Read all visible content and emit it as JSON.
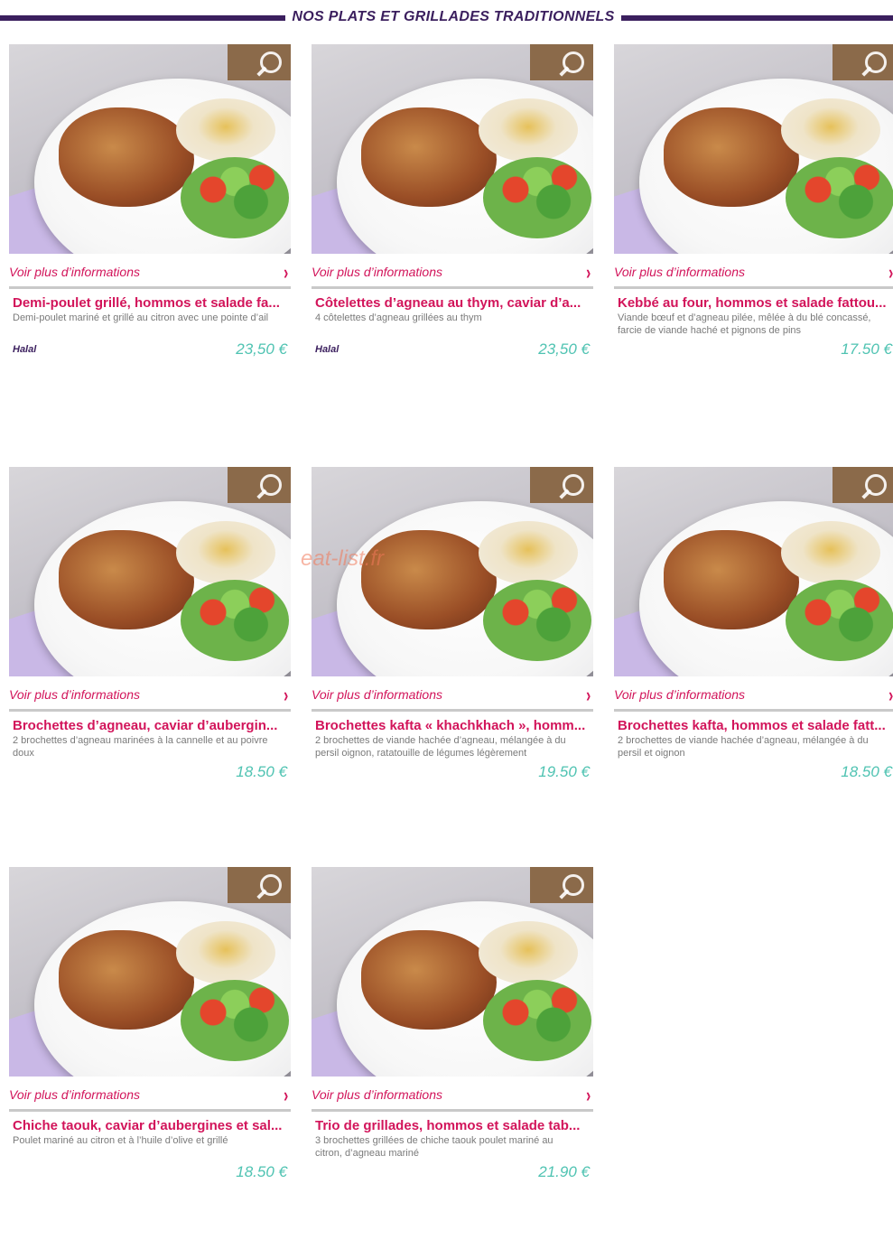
{
  "header": {
    "title": "NOS PLATS ET GRILLADES TRADITIONNELS"
  },
  "more_label": "Voir plus d’informations",
  "watermark": "eat-list.fr",
  "colors": {
    "accent_pink": "#d2145a",
    "price_teal": "#4fc3b2",
    "brand_purple": "#3b1f5e"
  },
  "icons": {
    "zoom": "zoom-icon",
    "chevron": "chevron-right-icon"
  },
  "cards": [
    {
      "title": "Demi-poulet grillé, hommos et salade fa...",
      "description": "Demi-poulet mariné et grillé au citron avec une pointe d’ail",
      "badge": "Halal",
      "price": "23,50 €",
      "arrow": "›"
    },
    {
      "title": "Côtelettes d’agneau au thym, caviar d’a...",
      "description": "4 côtelettes d’agneau grillées au thym",
      "badge": "Halal",
      "price": "23,50 €",
      "arrow": "›"
    },
    {
      "title": "Kebbé au four, hommos et salade fattou...",
      "description": "Viande bœuf et d’agneau pilée, mêlée à du blé concassé, farcie de viande haché et pignons de pins",
      "badge": "",
      "price": "17.50 €",
      "arrow": "›"
    },
    {
      "title": "Brochettes d’agneau, caviar d’aubergin...",
      "description": "2 brochettes d’agneau marinées à la cannelle et au poivre doux",
      "badge": "",
      "price": "18.50 €",
      "arrow": "›"
    },
    {
      "title": "Brochettes kafta « khachkhach », homm...",
      "description": "2 brochettes de viande hachée d’agneau, mélangée à du persil oignon, ratatouille de légumes légèrement",
      "badge": "",
      "price": "19.50 €",
      "arrow": "›"
    },
    {
      "title": "Brochettes kafta, hommos et salade fatt...",
      "description": "2 brochettes de viande hachée d’agneau, mélangée à du persil et oignon",
      "badge": "",
      "price": "18.50 €",
      "arrow": "›"
    },
    {
      "title": "Chiche taouk, caviar d’aubergines et sal...",
      "description": "Poulet mariné au citron et à l’huile d’olive et grillé",
      "badge": "",
      "price": "18.50 €",
      "arrow": "›"
    },
    {
      "title": "Trio de grillades, hommos et salade tab...",
      "description": "3 brochettes grillées de chiche taouk poulet mariné au citron, d’agneau mariné",
      "badge": "",
      "price": "21.90 €",
      "arrow": "›"
    }
  ]
}
